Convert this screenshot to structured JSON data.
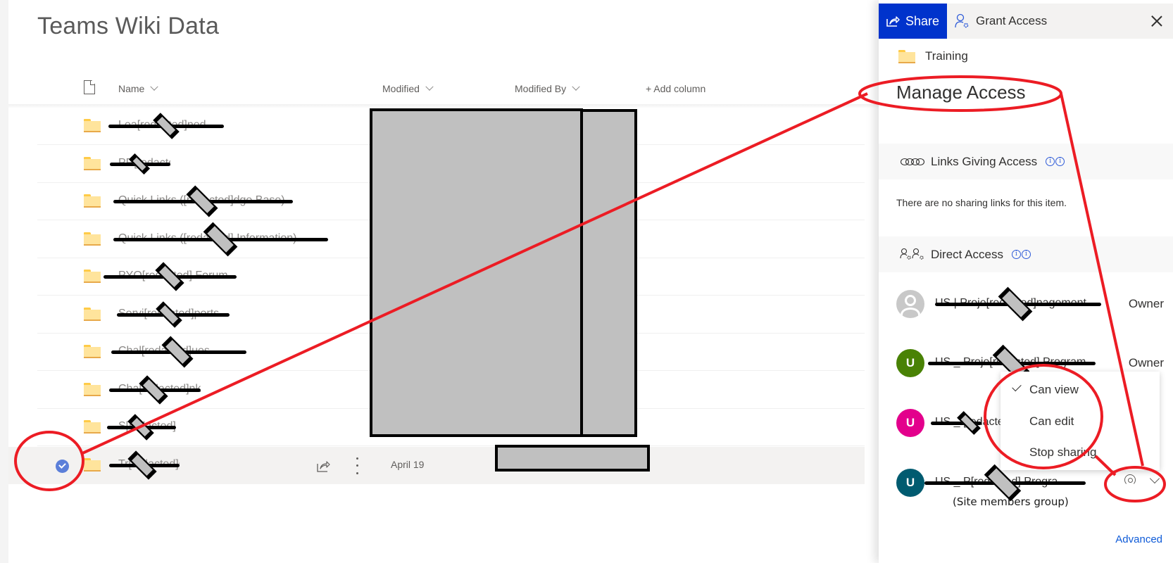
{
  "library": {
    "title": "Teams Wiki Data",
    "columns": {
      "type_icon": "file-icon",
      "name": "Name",
      "modified": "Modified",
      "modified_by": "Modified By",
      "add_column": "+ Add column"
    },
    "rows": [
      {
        "name": "Lea[redacted]ned",
        "icon": "folder-icon",
        "modified": "[redacted]",
        "modified_by": "[redacted]"
      },
      {
        "name": "PR[redacted]ER",
        "icon": "folder-icon",
        "modified": "[redacted]",
        "modified_by": "[redacted]"
      },
      {
        "name": "Quick Links ([redacted]dge Base)",
        "icon": "folder-icon",
        "modified": "[redacted]",
        "modified_by": "[redacted]"
      },
      {
        "name": "Quick Links ([redacted] Information)",
        "icon": "folder-icon",
        "modified": "[redacted]",
        "modified_by": "[redacted]"
      },
      {
        "name": "PYO[redacted] Forum",
        "icon": "folder-icon",
        "modified": "[redacted]",
        "modified_by": "[redacted]"
      },
      {
        "name": "Servi[redacted]ports",
        "icon": "folder-icon",
        "modified": "[redacted]",
        "modified_by": "[redacted]"
      },
      {
        "name": "Chal[redacted]ues",
        "icon": "folder-icon",
        "modified": "[redacted]",
        "modified_by": "[redacted]"
      },
      {
        "name": "Cha[redacted]nks",
        "icon": "folder-icon",
        "modified": "[redacted]",
        "modified_by": "[redacted]"
      },
      {
        "name": "S[redacted]gs",
        "icon": "folder-icon",
        "modified": "[redacted]",
        "modified_by": "[redacted]"
      },
      {
        "name": "Tr[redacted]g",
        "icon": "folder-icon",
        "modified": "April 19",
        "modified_by": "[redacted]",
        "selected": true
      }
    ]
  },
  "panel": {
    "share_label": "Share",
    "grant_access_label": "Grant Access",
    "close_icon": "close-icon",
    "item_name": "Training",
    "title": "Manage Access",
    "links_section": {
      "label": "Links Giving Access",
      "empty_text": "There are no sharing links for this item."
    },
    "direct_section": {
      "label": "Direct Access"
    },
    "users": [
      {
        "name": "US | Proje[redacted]nagement",
        "initial": "",
        "avatar_color": "#c8c8c8",
        "role": "Owner"
      },
      {
        "name": "US _ Proje[redacted] Program...",
        "initial": "U",
        "avatar_color": "#498205",
        "role": "Owner"
      },
      {
        "name": "US _ [redacted]oj",
        "initial": "U",
        "avatar_color": "#e3008c",
        "role": ""
      },
      {
        "name": "US _ P[redacted] Progra...",
        "initial": "U",
        "avatar_color": "#005b70",
        "role": "",
        "note": "(Site members group)",
        "permission_icon": "eye-icon"
      }
    ],
    "permission_menu": {
      "items": [
        {
          "label": "Can view",
          "checked": true
        },
        {
          "label": "Can edit",
          "checked": false
        },
        {
          "label": "Stop sharing",
          "checked": false
        }
      ]
    },
    "advanced_label": "Advanced"
  },
  "colors": {
    "share_blue": "#0033cc",
    "link_blue": "#0f5bd8",
    "annotation_red": "#ec1c24",
    "selected_check": "#5b7fd9"
  }
}
